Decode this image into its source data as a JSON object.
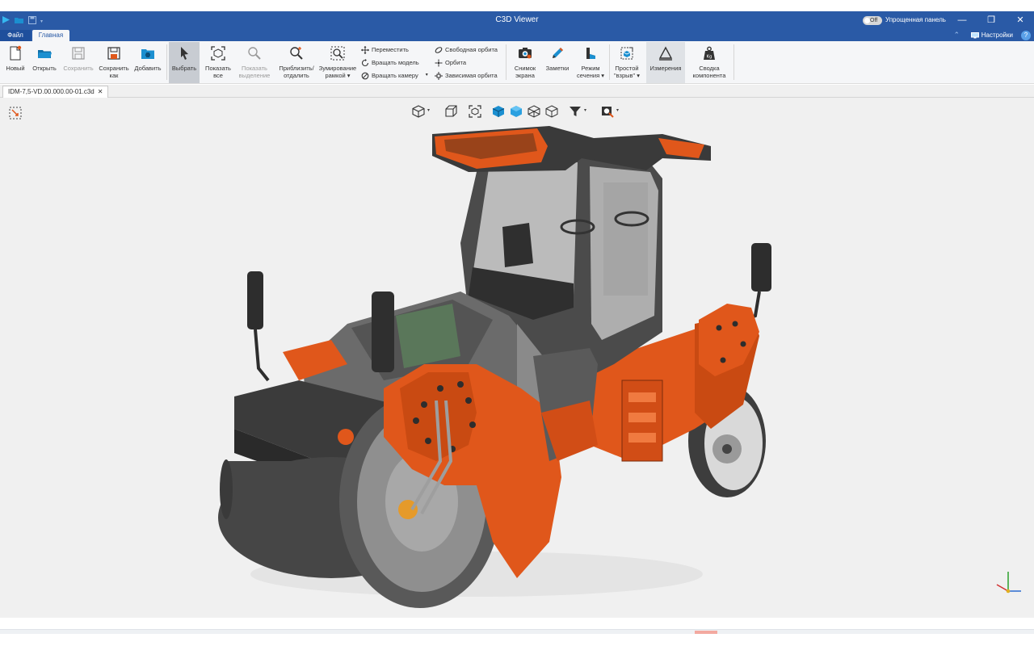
{
  "app": {
    "title": "C3D Viewer"
  },
  "titlebar": {
    "toggle_state": "Off",
    "toggle_label": "Упрощенная панель",
    "min": "—",
    "restore": "❐",
    "close": "✕"
  },
  "menu": {
    "file_tab": "Файл",
    "home_tab": "Главная",
    "settings_label": "Настройки",
    "help": "?"
  },
  "ribbon": {
    "new": "Новый",
    "open": "Открыть",
    "save": "Сохранить",
    "save_as_line1": "Сохранить",
    "save_as_line2": "как",
    "add": "Добавить",
    "select": "Выбрать",
    "show_all_line1": "Показать",
    "show_all_line2": "все",
    "show_sel_line1": "Показать",
    "show_sel_line2": "выделение",
    "zoom_line1": "Приблизить/",
    "zoom_line2": "отдалить",
    "zoom_frame_line1": "Зумирование",
    "zoom_frame_line2": "рамкой",
    "move": "Переместить",
    "rotate_model": "Вращать модель",
    "rotate_camera": "Вращать камеру",
    "free_orbit": "Свободная орбита",
    "orbit": "Орбита",
    "dependent_orbit": "Зависимая орбита",
    "snapshot_line1": "Снимок",
    "snapshot_line2": "экрана",
    "notes": "Заметки",
    "section_line1": "Режим",
    "section_line2": "сечения",
    "explode_line1": "Простой",
    "explode_line2": "\"взрыв\"",
    "measure": "Измерения",
    "summary_line1": "Сводка",
    "summary_line2": "компонента"
  },
  "document": {
    "tab_name": "IDM-7,5-VD.00.000.00-01.c3d",
    "close": "✕"
  },
  "colors": {
    "brand": "#2a5aa6",
    "accent_orange": "#e0571b",
    "viewport_bg": "#f0f0f0"
  }
}
